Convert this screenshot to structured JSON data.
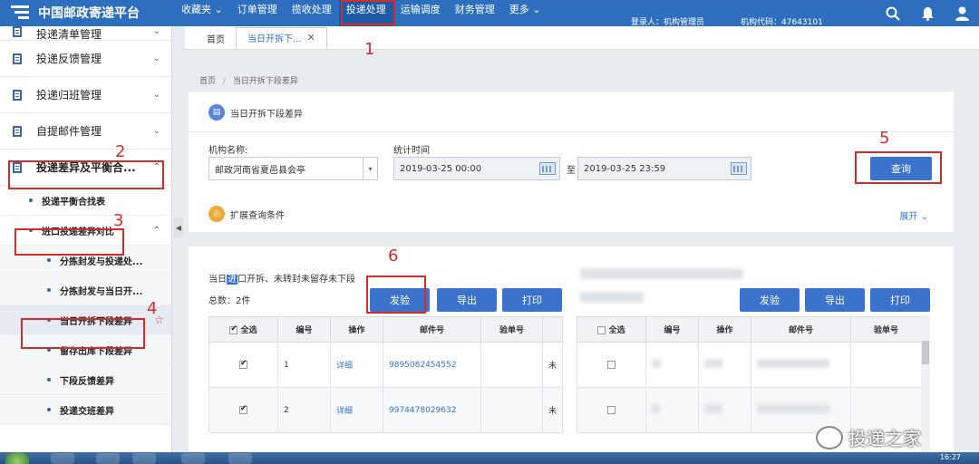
{
  "app": {
    "title": "中国邮政寄递平台"
  },
  "nav": {
    "items": [
      {
        "label": "收藏夹",
        "caret": "⌄"
      },
      {
        "label": "订单管理"
      },
      {
        "label": "揽收处理"
      },
      {
        "label": "投递处理"
      },
      {
        "label": "运输调度"
      },
      {
        "label": "财务管理"
      },
      {
        "label": "更多",
        "caret": "⌄"
      }
    ]
  },
  "user": {
    "login_label": "登录人：机构管理员",
    "org_code_label": "机构代码：47643101"
  },
  "sidebar": {
    "items": [
      {
        "label": "投递清单管理"
      },
      {
        "label": "投递反馈管理"
      },
      {
        "label": "投递归班管理"
      },
      {
        "label": "自提邮件管理"
      },
      {
        "label": "投递差异及平衡合..."
      }
    ],
    "sub": [
      {
        "label": "投递平衡合找表"
      },
      {
        "label": "进口投递差异对比"
      }
    ],
    "sub2": [
      {
        "label": "分拣封发与投递处..."
      },
      {
        "label": "分拣封发与当日开..."
      },
      {
        "label": "当日开拆下段差异"
      },
      {
        "label": "留存出库下段差异"
      },
      {
        "label": "下段反馈差异"
      },
      {
        "label": "投递交班差异"
      }
    ]
  },
  "tabs": [
    {
      "label": "首页"
    },
    {
      "label": "当日开拆下..."
    }
  ],
  "breadcrumb": {
    "home": "首页",
    "sep": "/",
    "current": "当日开拆下段差异"
  },
  "query": {
    "title": "当日开拆下段差异",
    "org_label": "机构名称:",
    "org_value": "邮政河南省夏邑县会亭",
    "time_label": "统计时间",
    "time_from": "2019-03-25 00:00",
    "time_sep": "至",
    "time_to": "2019-03-25 23:59",
    "search_btn": "查询",
    "expand_label": "扩展查询条件",
    "expand_link": "展开"
  },
  "result": {
    "caption_pre": "当日",
    "caption_hl": "进",
    "caption_post": "口开拆、未转封未留存未下段",
    "count": "总数：2件",
    "buttons": {
      "send": "发验",
      "export": "导出",
      "print": "打印"
    },
    "columns": [
      "全选",
      "编号",
      "操作",
      "邮件号",
      "验单号"
    ],
    "rows": [
      {
        "no": "1",
        "op": "详细",
        "mail_no": "9895082454552",
        "extra": "未"
      },
      {
        "no": "2",
        "op": "详细",
        "mail_no": "9974478029632",
        "extra": "未"
      }
    ]
  },
  "result2": {
    "buttons": {
      "send": "发验",
      "export": "导出",
      "print": "打印"
    },
    "columns": [
      "全选",
      "编号",
      "操作",
      "邮件号",
      "验单号"
    ]
  },
  "annotations": [
    "1",
    "2",
    "3",
    "4",
    "5",
    "6"
  ],
  "taskbar": {
    "clock": "16:27"
  },
  "watermark": "投递之家",
  "colors": {
    "brand": "#2d6fbe",
    "button": "#3a72cc",
    "annotation": "#d42b2b"
  }
}
